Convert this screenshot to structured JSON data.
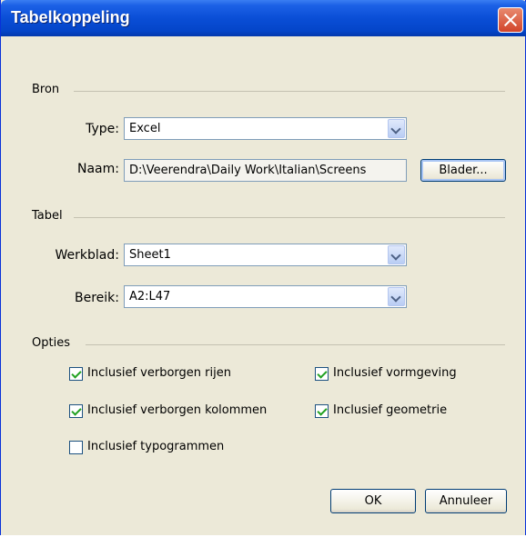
{
  "window": {
    "title": "Tabelkoppeling"
  },
  "bron": {
    "group_label": "Bron",
    "type_label": "Type:",
    "type_value": "Excel",
    "naam_label": "Naam:",
    "naam_value": "D:\\Veerendra\\Daily Work\\Italian\\Screens",
    "browse_label": "Blader..."
  },
  "tabel": {
    "group_label": "Tabel",
    "werkblad_label": "Werkblad:",
    "werkblad_value": "Sheet1",
    "bereik_label": "Bereik:",
    "bereik_value": "A2:L47"
  },
  "opties": {
    "group_label": "Opties",
    "items": [
      {
        "label": "Inclusief verborgen rijen",
        "checked": true
      },
      {
        "label": "Inclusief verborgen kolommen",
        "checked": true
      },
      {
        "label": "Inclusief typogrammen",
        "checked": false
      },
      {
        "label": "Inclusief vormgeving",
        "checked": true
      },
      {
        "label": "Inclusief geometrie",
        "checked": true
      }
    ]
  },
  "buttons": {
    "ok": "OK",
    "cancel": "Annuleer"
  }
}
